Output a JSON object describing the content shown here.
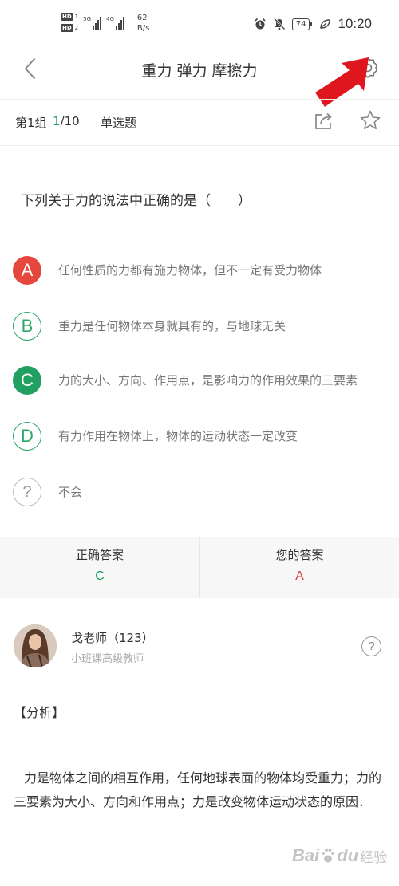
{
  "status_bar": {
    "sim1": "HD",
    "sim1_num": "1",
    "sim2": "HD",
    "sim2_num": "2",
    "net1": "5G",
    "net2": "4G",
    "speed_value": "62",
    "speed_unit": "B/s",
    "battery": "74",
    "time": "10:20"
  },
  "header": {
    "title": "重力 弹力 摩擦力",
    "arrow_color": "#e0161e"
  },
  "subheader": {
    "group": "第1组",
    "progress_current": "1",
    "progress_total": "/10",
    "question_type": "单选题"
  },
  "question": {
    "text": "下列关于力的说法中正确的是（　　）",
    "options": [
      {
        "letter": "A",
        "text": "任何性质的力都有施力物体，但不一定有受力物体",
        "state": "wrong"
      },
      {
        "letter": "B",
        "text": "重力是任何物体本身就具有的，与地球无关",
        "state": "plain"
      },
      {
        "letter": "C",
        "text": "力的大小、方向、作用点，是影响力的作用效果的三要素",
        "state": "right"
      },
      {
        "letter": "D",
        "text": "有力作用在物体上，物体的运动状态一定改变",
        "state": "plain"
      },
      {
        "letter": "?",
        "text": "不会",
        "state": "unknown"
      }
    ]
  },
  "answers": {
    "correct_label": "正确答案",
    "correct_value": "C",
    "yours_label": "您的答案",
    "yours_value": "A"
  },
  "teacher": {
    "name": "戈老师（123）",
    "title": "小班课高级教师",
    "help_icon": "?"
  },
  "analysis": {
    "heading": "【分析】",
    "body": "力是物体之间的相互作用，任何地球表面的物体均受重力；力的三要素为大小、方向和作用点；力是改变物体运动状态的原因．"
  },
  "watermark": {
    "brand": "Bai",
    "brand2": "du",
    "suffix": "经验"
  },
  "colors": {
    "green": "#22a061",
    "red": "#e6473c"
  }
}
